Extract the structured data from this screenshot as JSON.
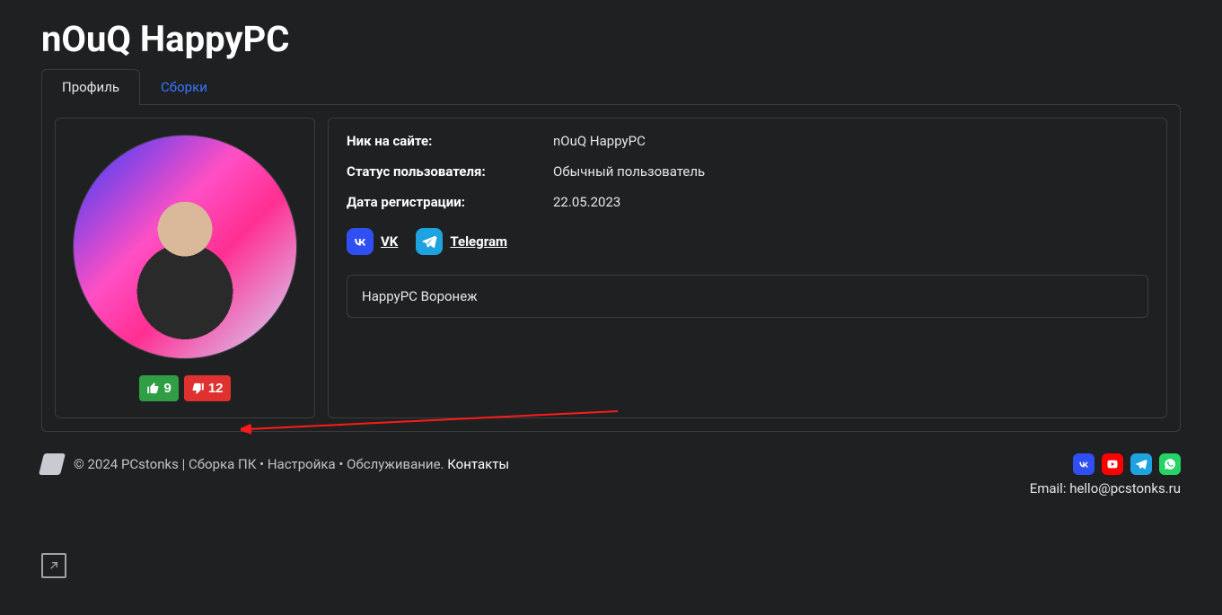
{
  "page_title": "nOuQ HappyPC",
  "tabs": {
    "profile": "Профиль",
    "builds": "Сборки"
  },
  "votes": {
    "up": "9",
    "down": "12"
  },
  "info": {
    "nick_label": "Ник на сайте:",
    "nick_value": "nOuQ HappyPC",
    "status_label": "Статус пользователя:",
    "status_value": "Обычный пользователь",
    "regdate_label": "Дата регистрации:",
    "regdate_value": "22.05.2023"
  },
  "social": {
    "vk": "VK",
    "telegram": "Telegram"
  },
  "bio": "HappyPC Воронеж",
  "footer": {
    "copyright": "© 2024 PCstonks | Сборка ПК • Настройка • Обслуживание.",
    "contacts": "Контакты",
    "email_label": "Email: ",
    "email": "hello@pcstonks.ru"
  }
}
